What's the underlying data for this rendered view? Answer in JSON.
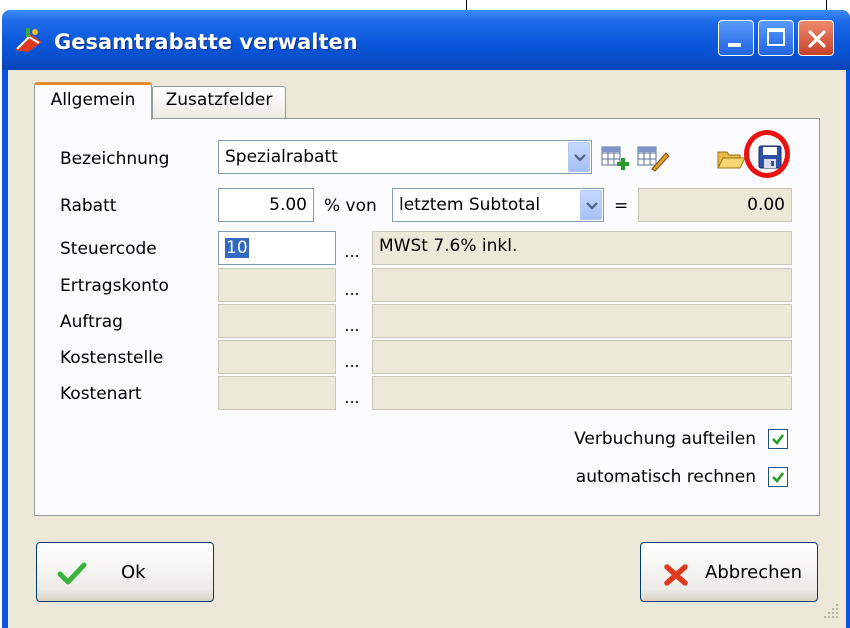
{
  "window": {
    "title": "Gesamtrabatte verwalten"
  },
  "tabs": [
    {
      "label": "Allgemein",
      "active": true
    },
    {
      "label": "Zusatzfelder",
      "active": false
    }
  ],
  "form": {
    "bezeichnung_label": "Bezeichnung",
    "bezeichnung_value": "Spezialrabatt",
    "rabatt_label": "Rabatt",
    "rabatt_value": "5.00",
    "prozent_von_label": "% von",
    "basis_value": "letztem Subtotal",
    "equals": "=",
    "result_value": "0.00",
    "steuercode_label": "Steuercode",
    "steuercode_value": "10",
    "steuercode_desc": "MWSt 7.6% inkl.",
    "ertragskonto_label": "Ertragskonto",
    "auftrag_label": "Auftrag",
    "kostenstelle_label": "Kostenstelle",
    "kostenart_label": "Kostenart",
    "lookup": "...",
    "verbuchung_label": "Verbuchung aufteilen",
    "verbuchung_checked": true,
    "automatisch_label": "automatisch rechnen",
    "automatisch_checked": true
  },
  "buttons": {
    "ok": "Ok",
    "cancel": "Abbrechen"
  },
  "colors": {
    "titlebar": "#0a55d9",
    "tab_highlight": "#e68b2c",
    "annotation_circle": "#ee1111"
  }
}
